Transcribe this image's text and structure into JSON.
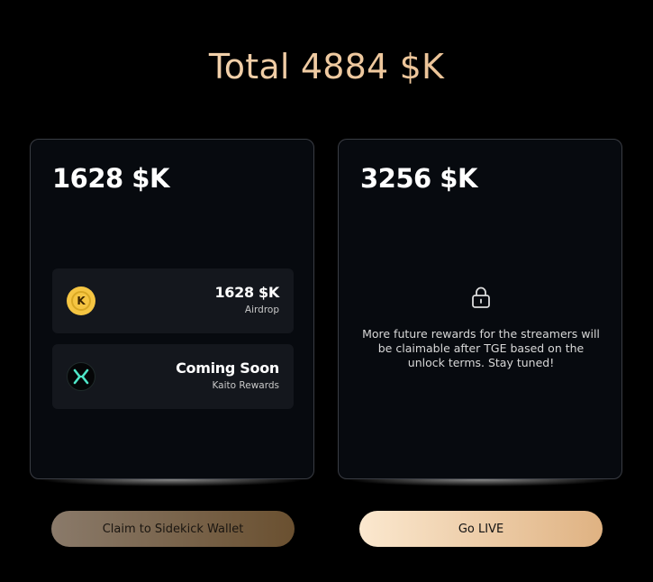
{
  "header": {
    "total": "Total 4884 $K"
  },
  "cards": [
    {
      "amount": "1628  $K",
      "rewards": [
        {
          "icon": "kaito-k-icon",
          "value": "1628 $K",
          "label": "Airdrop"
        },
        {
          "icon": "x-logo-icon",
          "value": "Coming Soon",
          "label": "Kaito Rewards"
        }
      ]
    },
    {
      "amount": "3256 $K",
      "lock_icon": "lock-icon",
      "message": "More future rewards for the streamers will be claimable after TGE based on the unlock terms. Stay tuned!"
    }
  ],
  "buttons": {
    "claim": "Claim to Sidekick Wallet",
    "live": "Go LIVE"
  },
  "colors": {
    "background": "#000000",
    "card": "#070a0f",
    "accent_gold": "#e7b887",
    "kaito_yellow": "#f5c542",
    "x_teal": "#4ee6c8"
  }
}
